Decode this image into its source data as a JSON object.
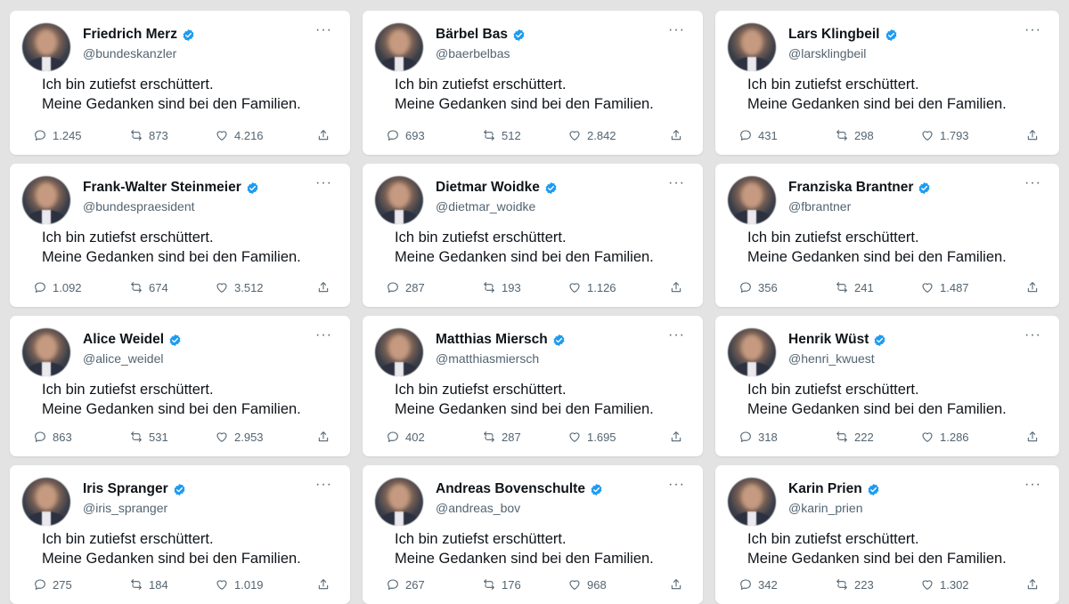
{
  "tweet_text": [
    "Ich bin zutiefst erschüttert.",
    "Meine Gedanken sind bei den Familien."
  ],
  "more_label": "···",
  "accent_color": "#1d9bf0",
  "icons": {
    "verified": "verified-badge-icon",
    "reply": "reply-icon",
    "retweet": "retweet-icon",
    "like": "heart-icon",
    "share": "share-icon",
    "more": "more-icon"
  },
  "cards": [
    {
      "name": "Friedrich Merz",
      "handle": "@bundeskanzler",
      "replies": "1.245",
      "retweets": "873",
      "likes": "4.216"
    },
    {
      "name": "Bärbel Bas",
      "handle": "@baerbelbas",
      "replies": "693",
      "retweets": "512",
      "likes": "2.842"
    },
    {
      "name": "Lars Klingbeil",
      "handle": "@larsklingbeil",
      "replies": "431",
      "retweets": "298",
      "likes": "1.793"
    },
    {
      "name": "Frank-Walter Steinmeier",
      "handle": "@bundespraesident",
      "replies": "1.092",
      "retweets": "674",
      "likes": "3.512"
    },
    {
      "name": "Dietmar Woidke",
      "handle": "@dietmar_woidke",
      "replies": "287",
      "retweets": "193",
      "likes": "1.126"
    },
    {
      "name": "Franziska Brantner",
      "handle": "@fbrantner",
      "replies": "356",
      "retweets": "241",
      "likes": "1.487"
    },
    {
      "name": "Alice Weidel",
      "handle": "@alice_weidel",
      "replies": "863",
      "retweets": "531",
      "likes": "2.953"
    },
    {
      "name": "Matthias Miersch",
      "handle": "@matthiasmiersch",
      "replies": "402",
      "retweets": "287",
      "likes": "1.695"
    },
    {
      "name": "Henrik Wüst",
      "handle": "@henri_kwuest",
      "replies": "318",
      "retweets": "222",
      "likes": "1.286"
    },
    {
      "name": "Iris Spranger",
      "handle": "@iris_spranger",
      "replies": "275",
      "retweets": "184",
      "likes": "1.019"
    },
    {
      "name": "Andreas Bovenschulte",
      "handle": "@andreas_bov",
      "replies": "267",
      "retweets": "176",
      "likes": "968"
    },
    {
      "name": "Karin Prien",
      "handle": "@karin_prien",
      "replies": "342",
      "retweets": "223",
      "likes": "1.302"
    }
  ]
}
